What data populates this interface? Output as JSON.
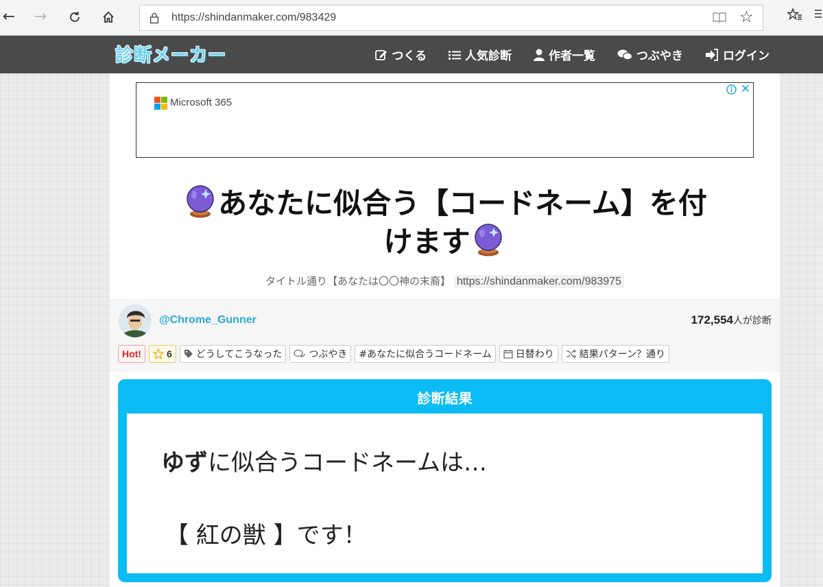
{
  "browser": {
    "url": "https://shindanmaker.com/983429"
  },
  "site": {
    "logo": "診断メーカー",
    "nav": [
      {
        "label": "つくる",
        "icon": "edit-icon"
      },
      {
        "label": "人気診断",
        "icon": "list-icon"
      },
      {
        "label": "作者一覧",
        "icon": "user-icon"
      },
      {
        "label": "つぶやき",
        "icon": "comments-icon"
      },
      {
        "label": "ログイン",
        "icon": "login-icon"
      }
    ]
  },
  "ad": {
    "brand": "Microsoft 365",
    "close": "✕"
  },
  "diagnosis": {
    "title_line1": "あなたに似合う【コードネーム】を付",
    "title_line2": "けます",
    "subtitle": "タイトル通り【あなたは〇〇神の末裔】",
    "subtitle_link": "https://shindanmaker.com/983975",
    "author": "@Chrome_Gunner",
    "count": "172,554",
    "count_suffix": "人が診断",
    "tags": {
      "hot": "Hot!",
      "fav": "6",
      "tag1": "どうしてこうなった",
      "tag2": "つぶやき",
      "tag3": "#あなたに似合うコードネーム",
      "tag4": "日替わり",
      "tag5": "結果パターン？通り"
    }
  },
  "result": {
    "header": "診断結果",
    "name": "ゆず",
    "line1_rest": "に似合うコードネームは…",
    "line2": "【 紅の獣 】です！"
  },
  "colors": {
    "accent": "#0bbcf5",
    "header_bg": "#4a4a4a",
    "author_link": "#2aa9d6"
  }
}
